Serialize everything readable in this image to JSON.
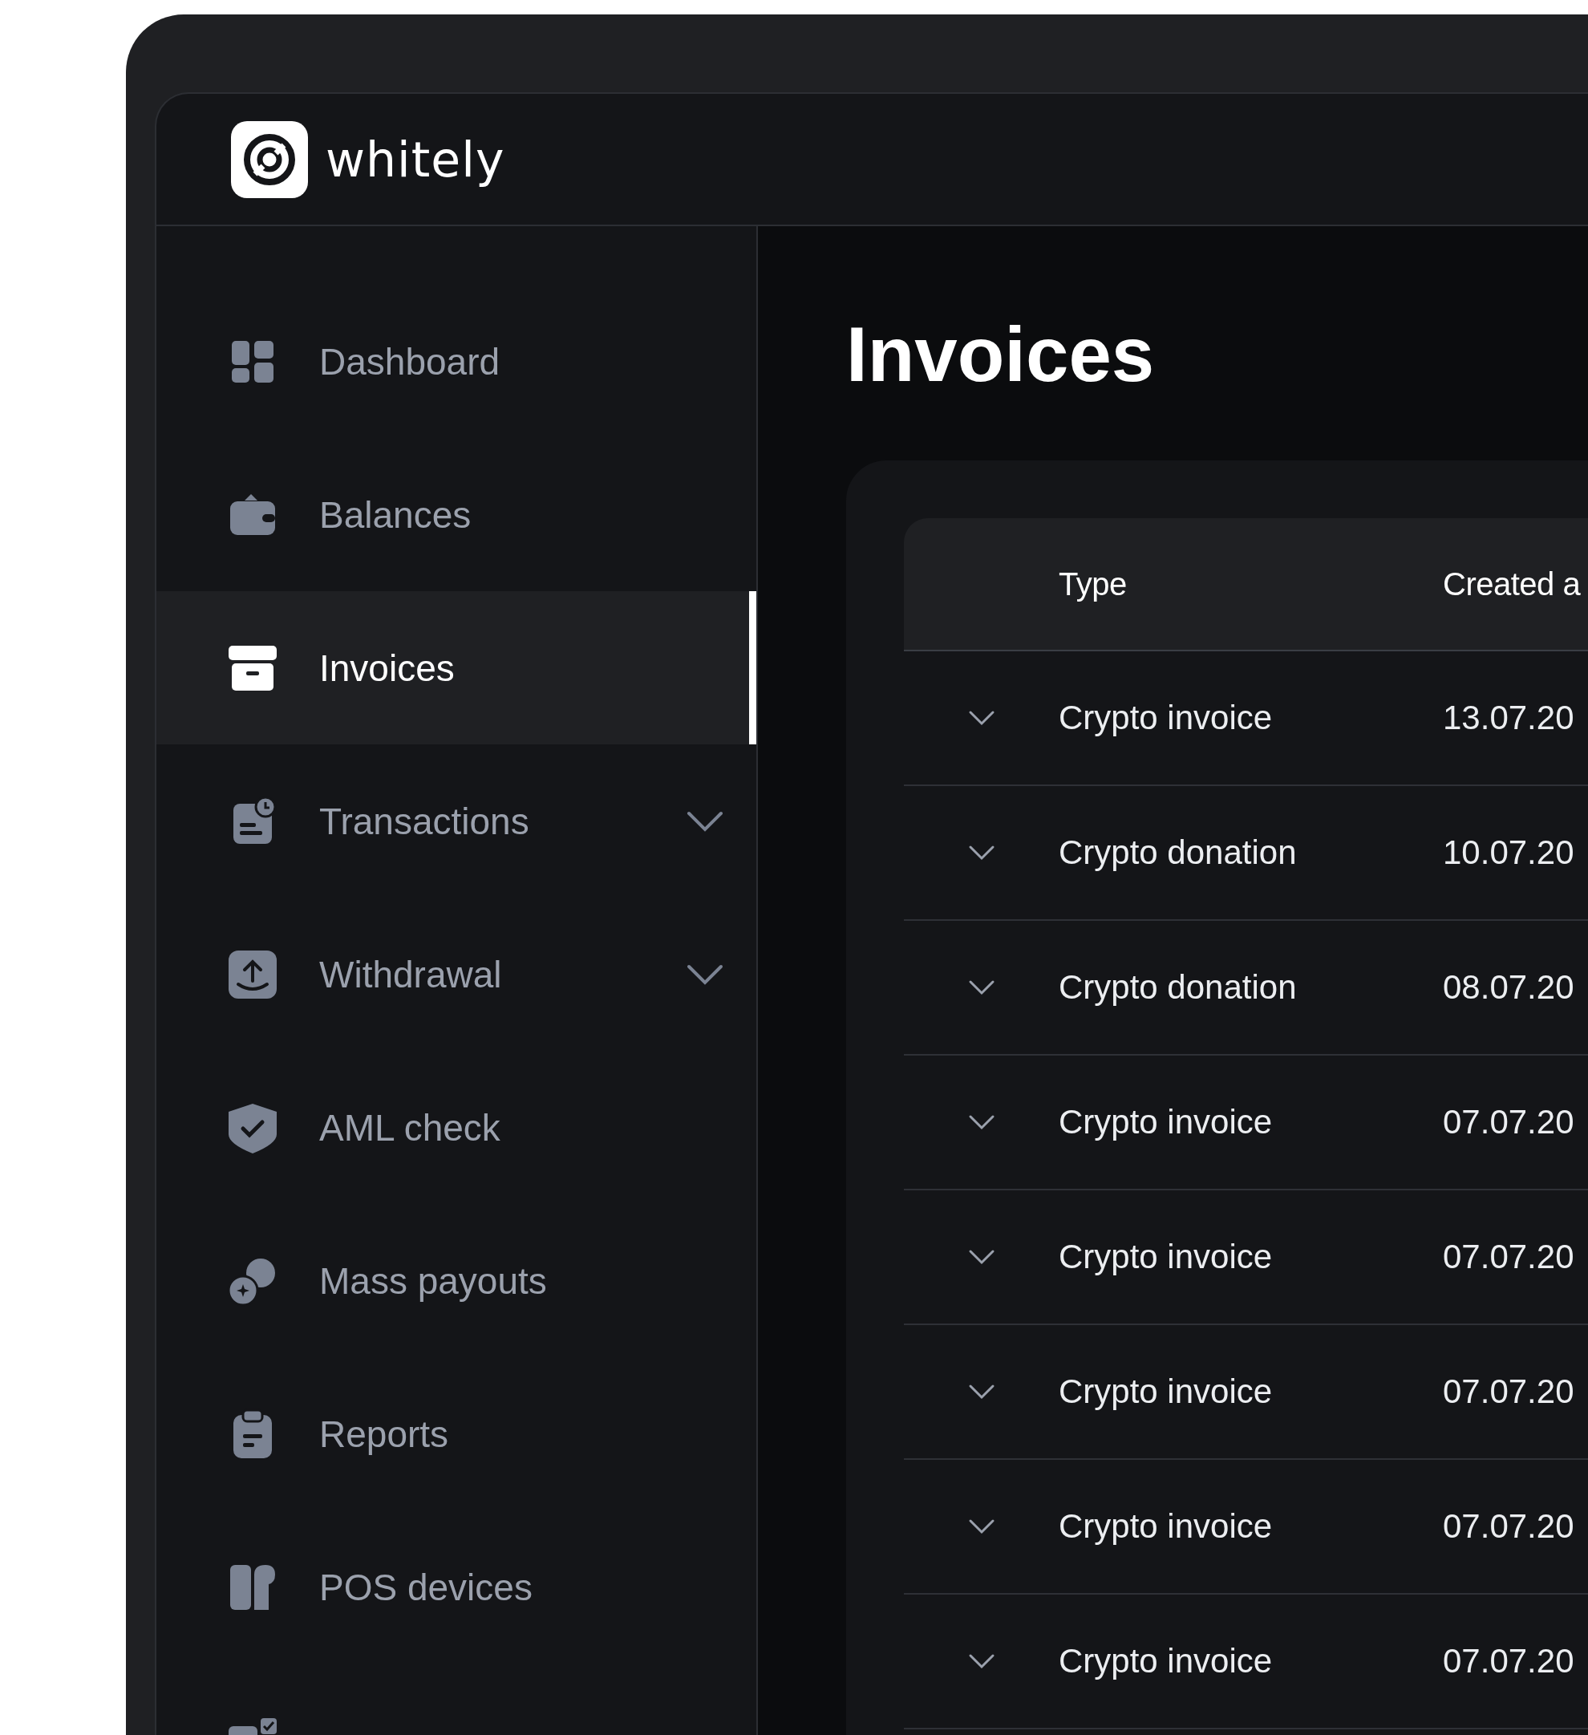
{
  "app": {
    "name": "whitely"
  },
  "sidebar": {
    "items": [
      {
        "label": "Dashboard",
        "selected": false,
        "expandable": false
      },
      {
        "label": "Balances",
        "selected": false,
        "expandable": false
      },
      {
        "label": "Invoices",
        "selected": true,
        "expandable": false
      },
      {
        "label": "Transactions",
        "selected": false,
        "expandable": true
      },
      {
        "label": "Withdrawal",
        "selected": false,
        "expandable": true
      },
      {
        "label": "AML check",
        "selected": false,
        "expandable": false
      },
      {
        "label": "Mass payouts",
        "selected": false,
        "expandable": false
      },
      {
        "label": "Reports",
        "selected": false,
        "expandable": false
      },
      {
        "label": "POS devices",
        "selected": false,
        "expandable": false
      },
      {
        "selected": false,
        "expandable": false
      }
    ]
  },
  "page": {
    "title": "Invoices"
  },
  "table": {
    "columns": [
      "Type",
      "Created a"
    ],
    "rows": [
      {
        "expanded": false,
        "cells": [
          "Crypto invoice",
          "13.07.20"
        ]
      },
      {
        "expanded": false,
        "cells": [
          "Crypto donation",
          "10.07.20"
        ]
      },
      {
        "expanded": false,
        "cells": [
          "Crypto donation",
          "08.07.20"
        ]
      },
      {
        "expanded": false,
        "cells": [
          "Crypto invoice",
          "07.07.20"
        ]
      },
      {
        "expanded": false,
        "cells": [
          "Crypto invoice",
          "07.07.20"
        ]
      },
      {
        "expanded": false,
        "cells": [
          "Crypto invoice",
          "07.07.20"
        ]
      },
      {
        "expanded": false,
        "cells": [
          "Crypto invoice",
          "07.07.20"
        ]
      },
      {
        "expanded": false,
        "cells": [
          "Crypto invoice",
          "07.07.20"
        ]
      }
    ]
  }
}
